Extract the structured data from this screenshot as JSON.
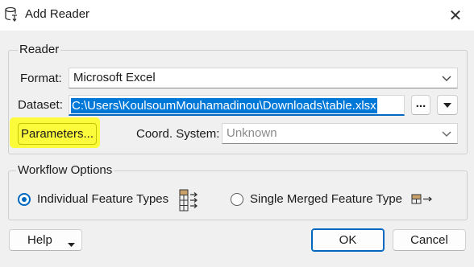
{
  "window": {
    "title": "Add Reader",
    "close_glyph": "✕"
  },
  "reader": {
    "group_label": "Reader",
    "format_label": "Format:",
    "format_value": "Microsoft Excel",
    "dataset_label": "Dataset:",
    "dataset_value": "C:\\Users\\KoulsoumMouhamadinou\\Downloads\\table.xlsx",
    "browse_label": "...",
    "parameters_label": "Parameters...",
    "coord_label": "Coord. System:",
    "coord_value": "Unknown"
  },
  "workflow": {
    "group_label": "Workflow Options",
    "individual_label": "Individual Feature Types",
    "individual_selected": true,
    "merged_label": "Single Merged Feature Type",
    "merged_selected": false
  },
  "footer": {
    "help_label": "Help",
    "ok_label": "OK",
    "cancel_label": "Cancel"
  },
  "colors": {
    "accent": "#0067c0",
    "selection": "#0078d7",
    "highlight": "#fbfb3c",
    "background": "#f0f0f0"
  },
  "icons": {
    "title": "reader-database-icon",
    "individual": "individual-feature-types-icon",
    "merged": "single-merged-feature-type-icon"
  }
}
